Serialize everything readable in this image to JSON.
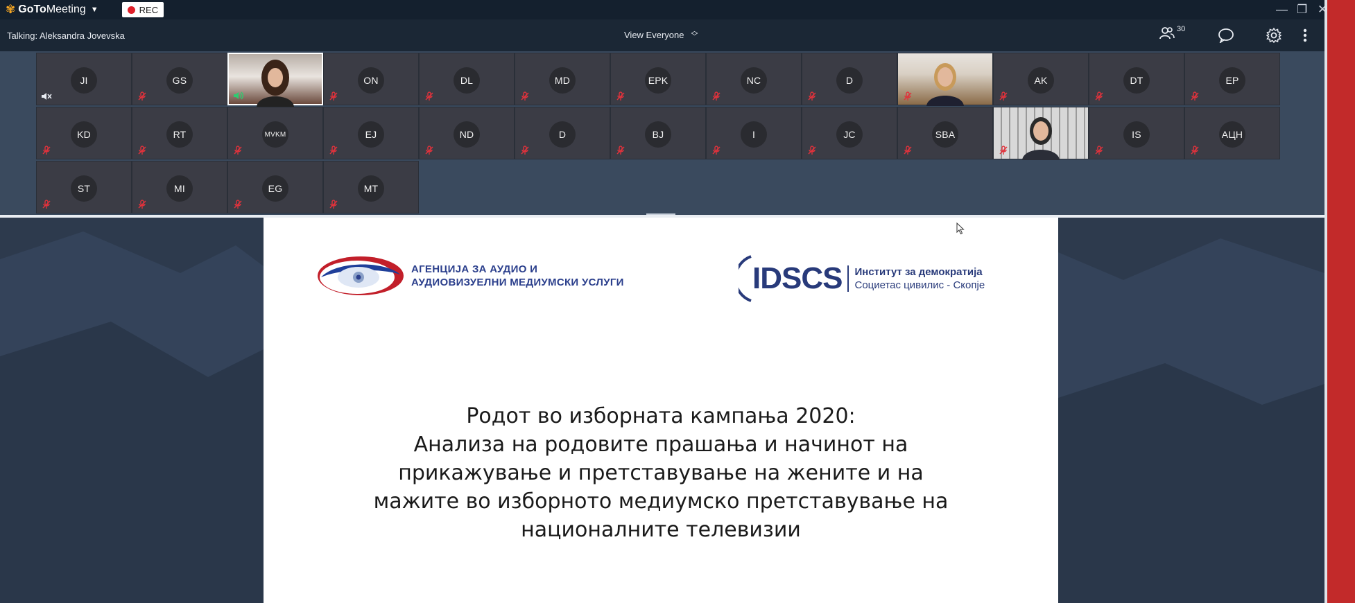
{
  "app": {
    "name_part1": "GoTo",
    "name_part2": "Meeting",
    "rec_label": "REC"
  },
  "toolbar": {
    "talking": "Talking: Aleksandra Jovevska",
    "view_label": "View Everyone",
    "attendee_count": "30"
  },
  "participants": [
    {
      "initials": "JI",
      "mic": "speaker-muted"
    },
    {
      "initials": "GS",
      "mic": "muted"
    },
    {
      "initials": "",
      "mic": "speaking",
      "video": "v1"
    },
    {
      "initials": "ON",
      "mic": "muted"
    },
    {
      "initials": "DL",
      "mic": "muted"
    },
    {
      "initials": "MD",
      "mic": "muted"
    },
    {
      "initials": "EPK",
      "mic": "muted"
    },
    {
      "initials": "NC",
      "mic": "muted"
    },
    {
      "initials": "D",
      "mic": "muted"
    },
    {
      "initials": "",
      "mic": "muted",
      "video": "v2"
    },
    {
      "initials": "AK",
      "mic": "muted"
    },
    {
      "initials": "DT",
      "mic": "muted"
    },
    {
      "initials": "EP",
      "mic": "muted"
    },
    {
      "initials": "KD",
      "mic": "muted"
    },
    {
      "initials": "RT",
      "mic": "muted"
    },
    {
      "initials": "MVKM",
      "mic": "muted"
    },
    {
      "initials": "EJ",
      "mic": "muted"
    },
    {
      "initials": "ND",
      "mic": "muted"
    },
    {
      "initials": "D",
      "mic": "muted"
    },
    {
      "initials": "BJ",
      "mic": "muted"
    },
    {
      "initials": "I",
      "mic": "muted"
    },
    {
      "initials": "JC",
      "mic": "muted"
    },
    {
      "initials": "SBA",
      "mic": "muted"
    },
    {
      "initials": "",
      "mic": "muted",
      "video": "v3"
    },
    {
      "initials": "IS",
      "mic": "muted"
    },
    {
      "initials": "АЦН",
      "mic": "muted"
    },
    {
      "initials": "ST",
      "mic": "muted"
    },
    {
      "initials": "MI",
      "mic": "muted"
    },
    {
      "initials": "EG",
      "mic": "muted"
    },
    {
      "initials": "MT",
      "mic": "muted"
    }
  ],
  "slide": {
    "agency_line1": "АГЕНЦИЈА ЗА АУДИО И",
    "agency_line2": "АУДИОВИЗУЕЛНИ МЕДИУМСКИ УСЛУГИ",
    "idscs_logo": "IDSCS",
    "idscs_line1": "Институт за демократија",
    "idscs_line2": "Социетас цивилис - Скопје",
    "title_lines": [
      "Родот во изборната кампања 2020:",
      "Анализа на родовите прашања и начинот на",
      "прикажување и претставување на жените и на",
      "мажите во изборното медиумско претставување на",
      "националните телевизии"
    ]
  },
  "colors": {
    "muted_red": "#e0323c",
    "speaking_green": "#2ecc71",
    "brand_orange": "#f5a623",
    "slide_navy": "#283a7a"
  }
}
